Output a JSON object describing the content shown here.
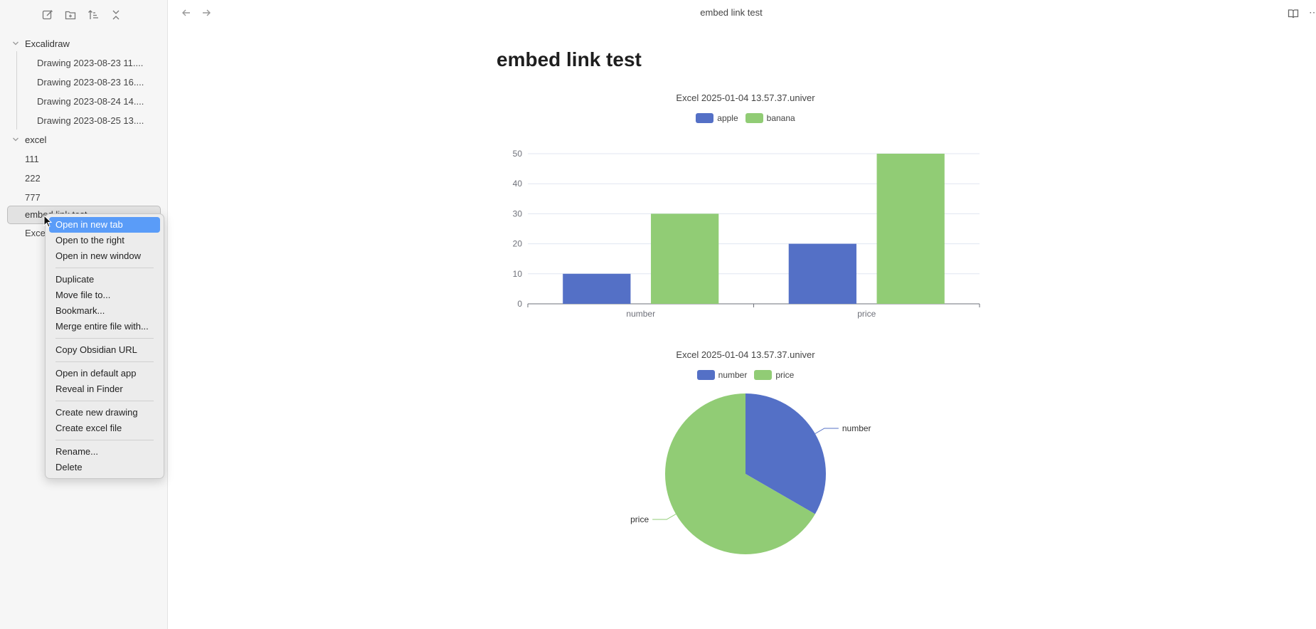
{
  "sidebar": {
    "toolbar": {
      "new_note_icon": "edit-icon",
      "new_folder_icon": "folder-plus-icon",
      "sort_icon": "sort-icon",
      "collapse_icon": "collapse-icon"
    },
    "tree": [
      {
        "type": "folder",
        "label": "Excalidraw"
      },
      {
        "type": "child",
        "label": "Drawing 2023-08-23 11...."
      },
      {
        "type": "child",
        "label": "Drawing 2023-08-23 16...."
      },
      {
        "type": "child",
        "label": "Drawing 2023-08-24 14...."
      },
      {
        "type": "child",
        "label": "Drawing 2023-08-25 13...."
      },
      {
        "type": "folder",
        "label": "excel"
      },
      {
        "type": "file",
        "label": "111"
      },
      {
        "type": "file",
        "label": "222"
      },
      {
        "type": "file",
        "label": "777"
      }
    ],
    "selected_label": "embed link test",
    "partial_label": "Exce"
  },
  "context_menu": {
    "groups": [
      [
        "Open in new tab",
        "Open to the right",
        "Open in new window"
      ],
      [
        "Duplicate",
        "Move file to...",
        "Bookmark...",
        "Merge entire file with..."
      ],
      [
        "Copy Obsidian URL"
      ],
      [
        "Open in default app",
        "Reveal in Finder"
      ],
      [
        "Create new drawing",
        "Create excel file"
      ],
      [
        "Rename...",
        "Delete"
      ]
    ],
    "active_item": "Open in new tab"
  },
  "topbar": {
    "title": "embed link test"
  },
  "document": {
    "title": "embed link test"
  },
  "colors": {
    "blue": "#5470c6",
    "green": "#91cc75"
  },
  "chart_data": [
    {
      "type": "bar",
      "title": "Excel 2025-01-04 13.57.37.univer",
      "categories": [
        "number",
        "price"
      ],
      "series": [
        {
          "name": "apple",
          "values": [
            10,
            20
          ],
          "color": "#5470c6"
        },
        {
          "name": "banana",
          "values": [
            30,
            50
          ],
          "color": "#91cc75"
        }
      ],
      "ylim": [
        0,
        50
      ],
      "yticks": [
        0,
        10,
        20,
        30,
        40,
        50
      ],
      "legend": "top-center",
      "grid": true
    },
    {
      "type": "pie",
      "title": "Excel 2025-01-04 13.57.37.univer",
      "slices": [
        {
          "name": "number",
          "value": 40,
          "color": "#5470c6"
        },
        {
          "name": "price",
          "value": 80,
          "color": "#91cc75"
        }
      ],
      "legend": "top-center"
    }
  ]
}
